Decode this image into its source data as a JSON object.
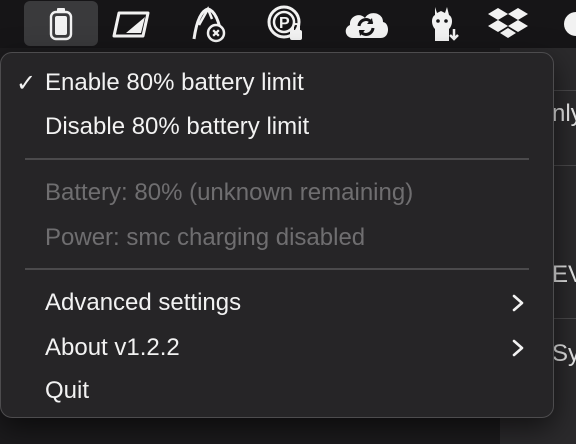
{
  "menubar": {
    "icons": [
      {
        "name": "battery-icon",
        "active": true
      },
      {
        "name": "window-icon",
        "active": false
      },
      {
        "name": "graph-icon",
        "active": false
      },
      {
        "name": "parking-lock-icon",
        "active": false
      },
      {
        "name": "cloud-sync-icon",
        "active": false
      },
      {
        "name": "alpaca-icon",
        "active": false
      },
      {
        "name": "dropbox-icon",
        "active": false
      },
      {
        "name": "partial-icon",
        "active": false
      }
    ]
  },
  "menu": {
    "enable_limit": {
      "check": "✓",
      "label": "Enable 80% battery limit",
      "checked": true
    },
    "disable_limit": {
      "label": "Disable 80% battery limit"
    },
    "battery_status": {
      "label": "Battery: 80% (unknown remaining)"
    },
    "power_status": {
      "label": "Power: smc charging disabled"
    },
    "advanced": {
      "label": "Advanced settings",
      "submenu": true
    },
    "about": {
      "label": "About v1.2.2",
      "submenu": true
    },
    "quit": {
      "label": "Quit"
    }
  },
  "background": {
    "row1": "nly",
    "row2": "EV",
    "row3": "Sy"
  },
  "colors": {
    "menu_bg": "#262527",
    "text": "#f2f2f2",
    "disabled_text": "#6f6e70",
    "active_icon_bg": "#3a3a3c"
  }
}
